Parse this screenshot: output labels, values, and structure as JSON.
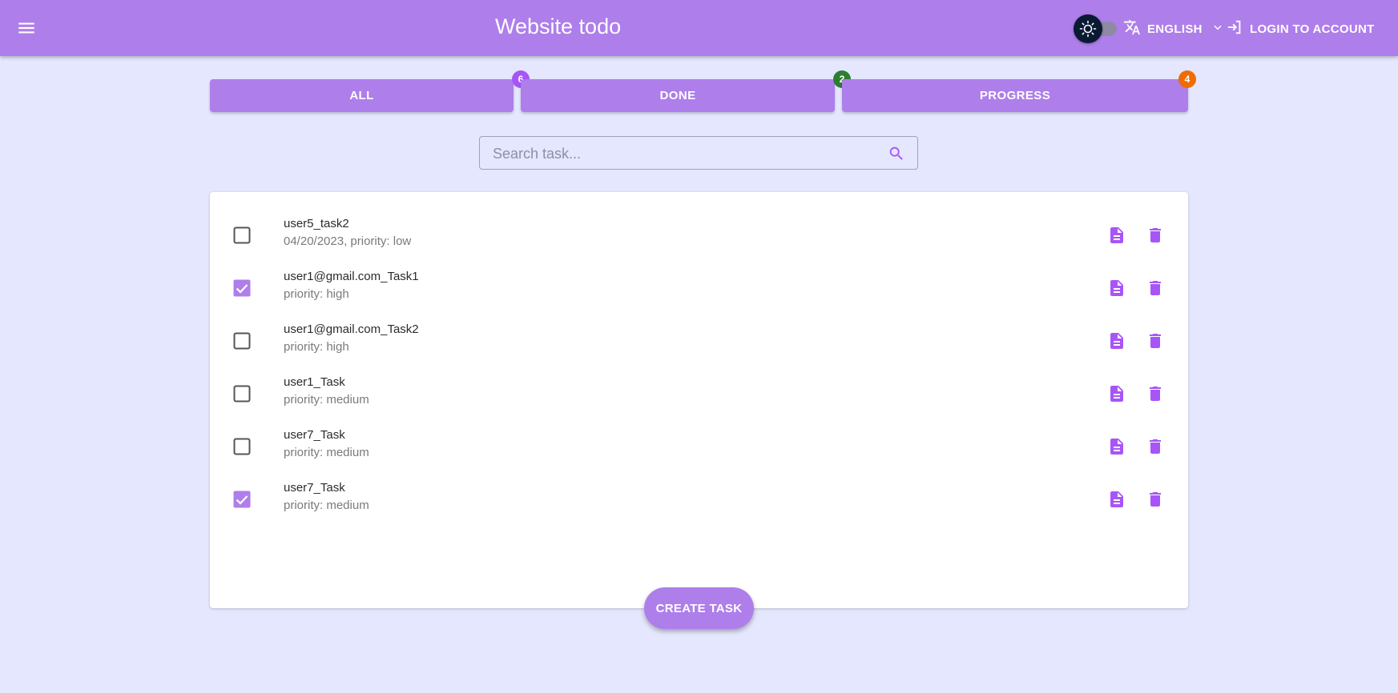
{
  "app": {
    "title": "Website todo",
    "language_label": "ENGLISH",
    "login_label": "LOGIN TO ACCOUNT"
  },
  "tabs": [
    {
      "label": "ALL",
      "count": "6",
      "badge_color": "#a855f7"
    },
    {
      "label": "DONE",
      "count": "2",
      "badge_color": "#2e7d32"
    },
    {
      "label": "PROGRESS",
      "count": "4",
      "badge_color": "#ef6c00"
    }
  ],
  "search": {
    "placeholder": "Search task...",
    "value": ""
  },
  "tasks": [
    {
      "title": "user5_task2",
      "subtitle": "04/20/2023, priority: low",
      "checked": false
    },
    {
      "title": "user1@gmail.com_Task1",
      "subtitle": "priority: high",
      "checked": true
    },
    {
      "title": "user1@gmail.com_Task2",
      "subtitle": "priority: high",
      "checked": false
    },
    {
      "title": "user1_Task",
      "subtitle": "priority: medium",
      "checked": false
    },
    {
      "title": "user7_Task",
      "subtitle": "priority: medium",
      "checked": false
    },
    {
      "title": "user7_Task",
      "subtitle": "priority: medium",
      "checked": true
    }
  ],
  "create_button": {
    "label": "CREATE TASK"
  },
  "colors": {
    "accent": "#ae7eea",
    "icon_purple": "#a855f7",
    "background": "#e4e7fd",
    "toggle_thumb": "#0b1a33"
  },
  "icons": [
    "menu-icon",
    "sun-icon",
    "translate-icon",
    "chevron-down-icon",
    "login-icon",
    "search-icon",
    "document-icon",
    "trash-icon",
    "checkbox-icon"
  ]
}
